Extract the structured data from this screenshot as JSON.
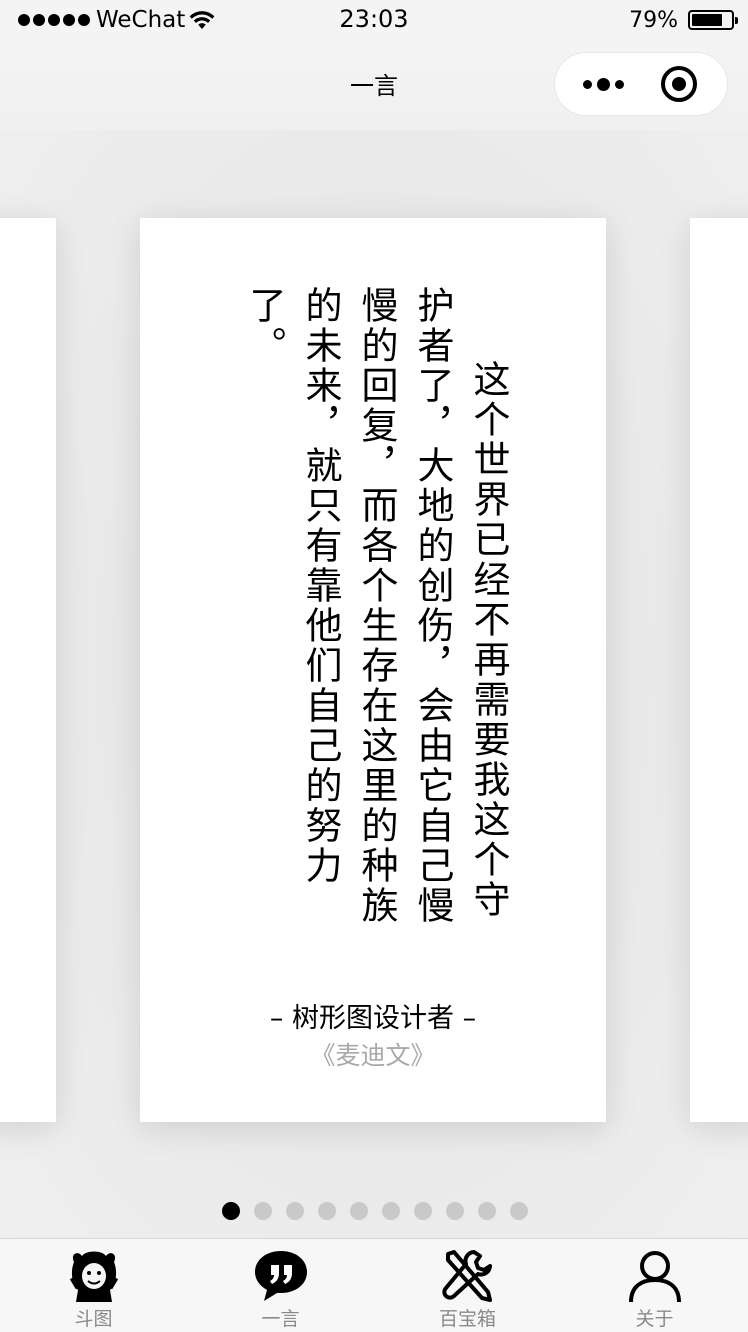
{
  "status_bar": {
    "carrier": "WeChat",
    "time": "23:03",
    "battery_percent_text": "79%",
    "battery_level": 0.79,
    "icons": [
      "signal-dots-icon",
      "wifi-icon",
      "battery-icon"
    ]
  },
  "nav": {
    "title": "一言",
    "capsule_icons": [
      "more-icon",
      "close-miniprogram-icon"
    ]
  },
  "quote": {
    "text": "这个世界已经不再需要我这个守护者了，大地的创伤，会由它自己慢慢的回复，而各个生存在这里的种族的未来，就只有靠他们自己的努力了。",
    "author": "– 树形图设计者 –",
    "source": "《麦迪文》"
  },
  "pagination": {
    "total": 10,
    "active_index": 0
  },
  "tabs": [
    {
      "label": "斗图",
      "icon": "meme-face-icon"
    },
    {
      "label": "一言",
      "icon": "quote-bubble-icon"
    },
    {
      "label": "百宝箱",
      "icon": "tools-icon"
    },
    {
      "label": "关于",
      "icon": "person-icon"
    }
  ],
  "colors": {
    "background": "#ededed",
    "card": "#ffffff",
    "text": "#000000",
    "muted_text": "#a9a9a9",
    "tab_label": "#8a8a8a",
    "dot_inactive": "#c9c9c9",
    "dot_active": "#000000"
  }
}
